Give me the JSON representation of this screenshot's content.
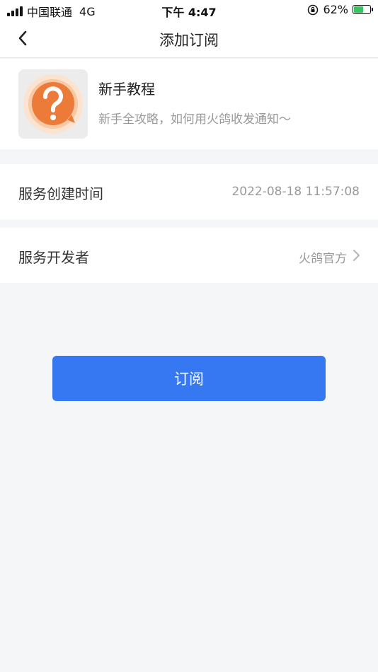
{
  "status_bar": {
    "carrier": "中国联通",
    "network": "4G",
    "time": "下午 4:47",
    "battery": "62%",
    "battery_level": 0.62
  },
  "nav": {
    "title": "添加订阅"
  },
  "service": {
    "name": "新手教程",
    "description": "新手全攻略，如何用火鸽收发通知～",
    "icon": "question-bubble-icon"
  },
  "info": {
    "created_label": "服务创建时间",
    "created_value": "2022-08-18 11:57:08",
    "developer_label": "服务开发者",
    "developer_value": "火鸽官方"
  },
  "actions": {
    "subscribe_label": "订阅"
  },
  "colors": {
    "primary": "#3678f2",
    "icon_orange": "#ec7a38",
    "battery_green": "#34c759"
  }
}
